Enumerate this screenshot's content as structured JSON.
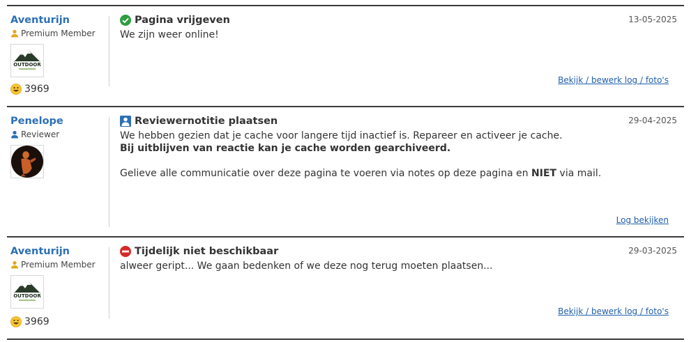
{
  "logs": [
    {
      "user": {
        "name": "Aventurijn",
        "role": "Premium Member",
        "avatar_text": "OUTDOOR",
        "points": "3969"
      },
      "type_icon": "check-circle-icon",
      "title": "Pagina vrijgeven",
      "date": "13-05-2025",
      "text": [
        "We zijn weer online!"
      ],
      "link": "Bekijk / bewerk log / foto's"
    },
    {
      "user": {
        "name": "Penelope",
        "role": "Reviewer"
      },
      "type_icon": "reviewer-note-icon",
      "title": "Reviewernotitie plaatsen",
      "date": "29-04-2025",
      "text_line1": "We hebben gezien dat je cache voor langere tijd inactief is. Repareer en activeer je cache.",
      "text_bold": "Bij uitblijven van reactie kan je cache worden gearchiveerd.",
      "text_line3_before": "Gelieve alle communicatie over deze pagina te voeren via notes op deze pagina en ",
      "text_line3_bold": "NIET",
      "text_line3_after": " via mail.",
      "link": "Log bekijken"
    },
    {
      "user": {
        "name": "Aventurijn",
        "role": "Premium Member",
        "avatar_text": "OUTDOOR",
        "points": "3969"
      },
      "type_icon": "no-entry-icon",
      "title": "Tijdelijk niet beschikbaar",
      "date": "29-03-2025",
      "text": [
        "alweer geript... We gaan bedenken of we deze nog terug moeten plaatsen..."
      ],
      "link": "Bekijk / bewerk log / foto's"
    }
  ],
  "colors": {
    "username": "#2c6fb6",
    "link": "#1f5fad",
    "check": "#2e9e3f",
    "noentry": "#d42a2a",
    "reviewer": "#2c6fb6"
  }
}
